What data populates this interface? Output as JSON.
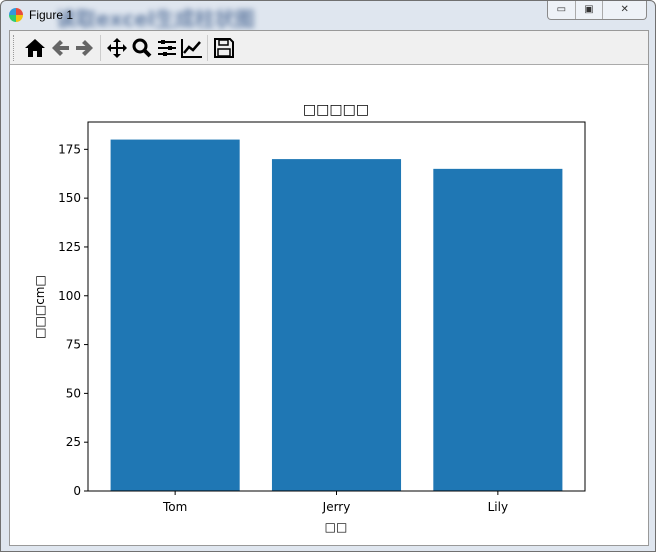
{
  "window": {
    "title": "Figure 1",
    "blurred_title": "读取excel生成柱状图"
  },
  "toolbar": {
    "icons": [
      "home-icon",
      "back-arrow-icon",
      "forward-arrow-icon",
      "pan-move-icon",
      "zoom-magnifier-icon",
      "configure-subplots-icon",
      "edit-axis-icon",
      "save-floppy-icon"
    ]
  },
  "chart_data": {
    "type": "bar",
    "title": "□□□□□",
    "xlabel": "□□",
    "ylabel": "□□□cm□",
    "categories": [
      "Tom",
      "Jerry",
      "Lily"
    ],
    "values": [
      180,
      170,
      165
    ],
    "ylim": [
      0,
      189
    ],
    "yticks": [
      0,
      25,
      50,
      75,
      100,
      125,
      150,
      175
    ],
    "color": "#1f77b4",
    "grid": false
  }
}
